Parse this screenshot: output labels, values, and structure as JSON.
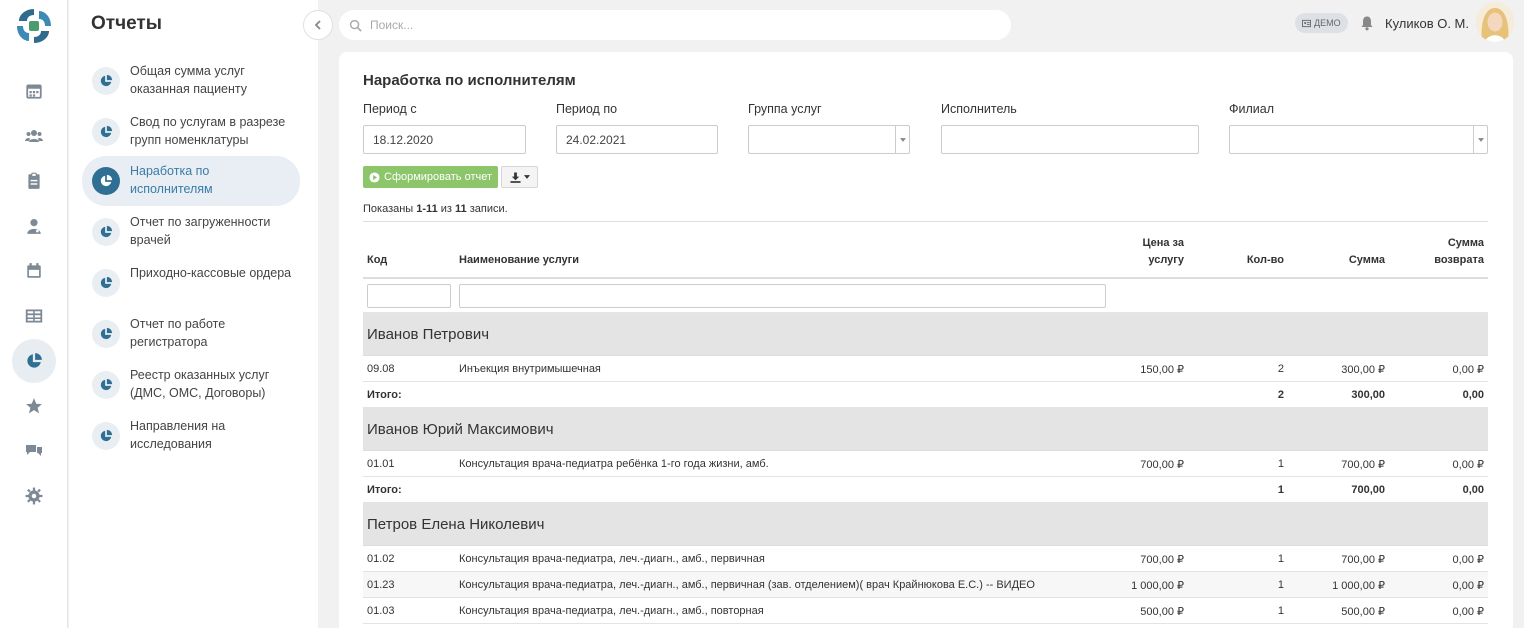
{
  "sidebar": {
    "title": "Отчеты",
    "items": [
      {
        "label": "Общая сумма услуг оказанная пациенту"
      },
      {
        "label": "Свод по услугам в разрезе групп номенклатуры"
      },
      {
        "label": "Наработка по исполнителям"
      },
      {
        "label": "Отчет по загруженности врачей"
      },
      {
        "label": "Приходно-кассовые ордера"
      },
      {
        "label": "Отчет по работе регистратора"
      },
      {
        "label": "Реестр оказанных услуг (ДМС, ОМС, Договоры)"
      },
      {
        "label": "Направления на исследования"
      }
    ],
    "active_index": 2
  },
  "rail": {
    "icons": [
      "calendar-icon",
      "users-icon",
      "clipboard-icon",
      "doctor-icon",
      "calendar-alt-icon",
      "table-icon",
      "pie-chart-icon",
      "star-icon",
      "chat-icon",
      "gear-icon"
    ],
    "active": "pie-chart-icon"
  },
  "topbar": {
    "search_placeholder": "Поиск...",
    "demo_badge": "ДЕМО",
    "user_name": "Куликов О. М."
  },
  "report": {
    "title": "Наработка по исполнителям",
    "filters": {
      "period_from_label": "Период с",
      "period_from_value": "18.12.2020",
      "period_to_label": "Период по",
      "period_to_value": "24.02.2021",
      "service_group_label": "Группа услуг",
      "service_group_value": "",
      "performer_label": "Исполнитель",
      "performer_value": "",
      "branch_label": "Филиал",
      "branch_value": ""
    },
    "generate_button": "Сформировать отчет",
    "summary": {
      "prefix": "Показаны ",
      "range": "1-11",
      "middle": " из ",
      "total": "11",
      "suffix": " записи."
    },
    "columns": {
      "code": "Код",
      "name": "Наименование услуги",
      "price_line1": "Цена за",
      "price_line2": "услугу",
      "qty": "Кол-во",
      "sum": "Сумма",
      "ret_line1": "Сумма",
      "ret_line2": "возврата"
    },
    "total_label": "Итого:",
    "groups": [
      {
        "name": "Иванов Петрович",
        "rows": [
          {
            "code": "09.08",
            "name": "Инъекция внутримышечная",
            "price": "150,00 ₽",
            "qty": "2",
            "sum": "300,00 ₽",
            "ret": "0,00 ₽"
          }
        ],
        "total": {
          "qty": "2",
          "sum": "300,00",
          "ret": "0,00"
        }
      },
      {
        "name": "Иванов Юрий Максимович",
        "rows": [
          {
            "code": "01.01",
            "name": "Консультация врача-педиатра ребёнка 1-го года жизни, амб.",
            "price": "700,00 ₽",
            "qty": "1",
            "sum": "700,00 ₽",
            "ret": "0,00 ₽"
          }
        ],
        "total": {
          "qty": "1",
          "sum": "700,00",
          "ret": "0,00"
        }
      },
      {
        "name": "Петров Елена Николевич",
        "rows": [
          {
            "code": "01.02",
            "name": "Консультация врача-педиатра, леч.-диагн., амб., первичная",
            "price": "700,00 ₽",
            "qty": "1",
            "sum": "700,00 ₽",
            "ret": "0,00 ₽"
          },
          {
            "code": "01.23",
            "name": "Консультация врача-педиатра, леч.-диагн., амб., первичная (зав. отделением)( врач Крайнюкова Е.С.) -- ВИДЕО",
            "price": "1 000,00 ₽",
            "qty": "1",
            "sum": "1 000,00 ₽",
            "ret": "0,00 ₽"
          },
          {
            "code": "01.03",
            "name": "Консультация врача-педиатра, леч.-диагн., амб., повторная",
            "price": "500,00 ₽",
            "qty": "1",
            "sum": "500,00 ₽",
            "ret": "0,00 ₽"
          }
        ]
      }
    ]
  }
}
